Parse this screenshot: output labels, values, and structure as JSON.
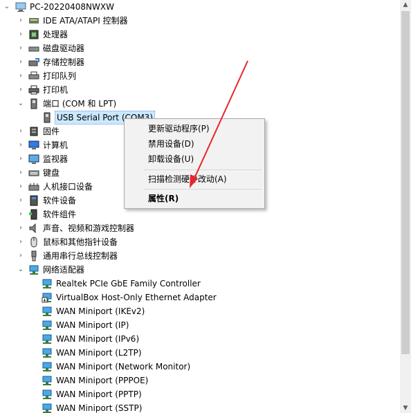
{
  "tree": {
    "root": "PC-20220408NWXW",
    "categories": [
      {
        "label": "IDE ATA/ATAPI 控制器",
        "expanded": false
      },
      {
        "label": "处理器",
        "expanded": false
      },
      {
        "label": "磁盘驱动器",
        "expanded": false
      },
      {
        "label": "存储控制器",
        "expanded": false
      },
      {
        "label": "打印队列",
        "expanded": false
      },
      {
        "label": "打印机",
        "expanded": false
      },
      {
        "label": "端口 (COM 和 LPT)",
        "expanded": true
      },
      {
        "label": "USB Serial Port (COM3)",
        "expanded": false
      },
      {
        "label": "固件",
        "expanded": false
      },
      {
        "label": "计算机",
        "expanded": false
      },
      {
        "label": "监视器",
        "expanded": false
      },
      {
        "label": "键盘",
        "expanded": false
      },
      {
        "label": "人机接口设备",
        "expanded": false
      },
      {
        "label": "软件设备",
        "expanded": false
      },
      {
        "label": "软件组件",
        "expanded": false
      },
      {
        "label": "声音、视频和游戏控制器",
        "expanded": false
      },
      {
        "label": "鼠标和其他指针设备",
        "expanded": false
      },
      {
        "label": "通用串行总线控制器",
        "expanded": false
      },
      {
        "label": "网络适配器",
        "expanded": true
      },
      {
        "label": "Realtek PCIe GbE Family Controller",
        "expanded": false
      },
      {
        "label": "VirtualBox Host-Only Ethernet Adapter",
        "expanded": false
      },
      {
        "label": "WAN Miniport (IKEv2)",
        "expanded": false
      },
      {
        "label": "WAN Miniport (IP)",
        "expanded": false
      },
      {
        "label": "WAN Miniport (IPv6)",
        "expanded": false
      },
      {
        "label": "WAN Miniport (L2TP)",
        "expanded": false
      },
      {
        "label": "WAN Miniport (Network Monitor)",
        "expanded": false
      },
      {
        "label": "WAN Miniport (PPPOE)",
        "expanded": false
      },
      {
        "label": "WAN Miniport (PPTP)",
        "expanded": false
      },
      {
        "label": "WAN Miniport (SSTP)",
        "expanded": false
      }
    ]
  },
  "context_menu": {
    "items": [
      "更新驱动程序(P)",
      "禁用设备(D)",
      "卸载设备(U)",
      "扫描检测硬件改动(A)",
      "属性(R)"
    ]
  },
  "annotation": {
    "arrow_color": "#e8252a"
  },
  "colors": {
    "selection": "#cce8ff",
    "menu_bg": "#f2f2f2"
  }
}
